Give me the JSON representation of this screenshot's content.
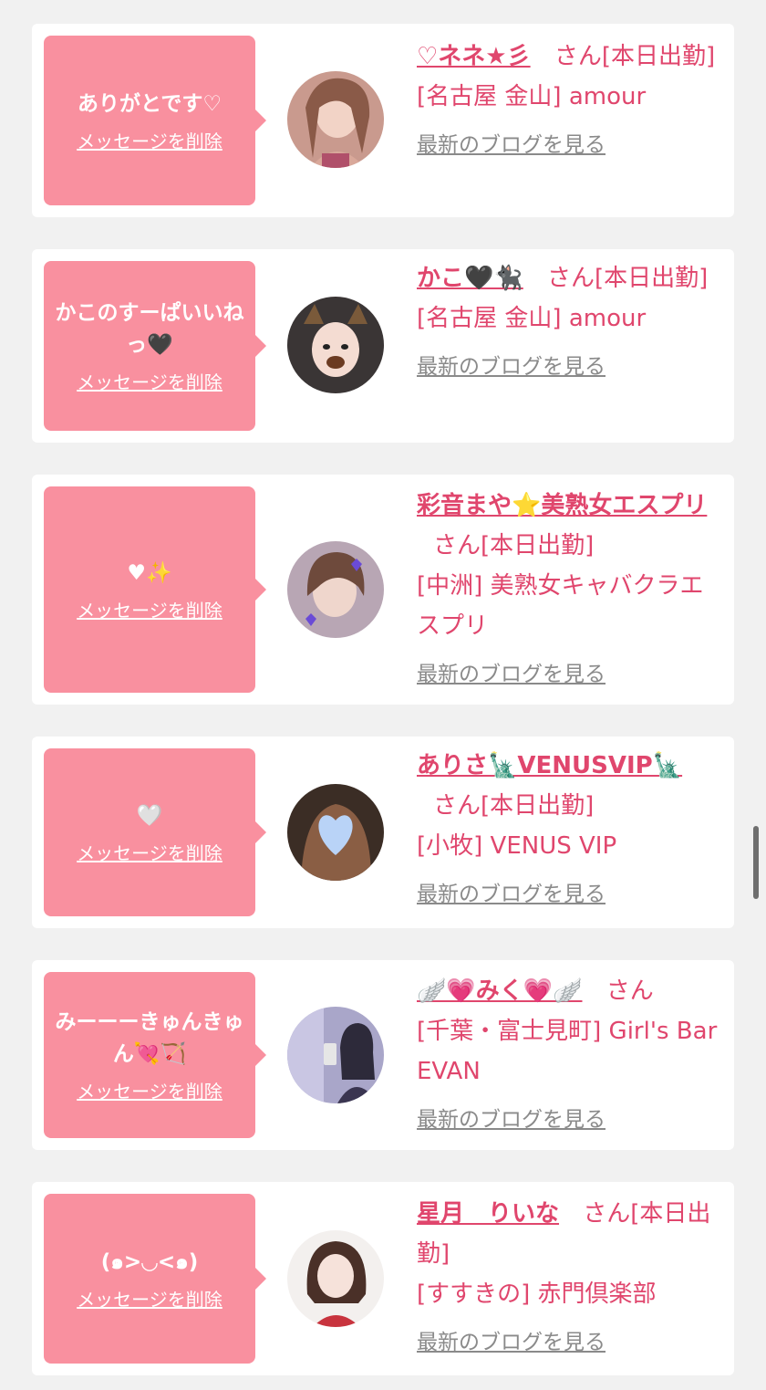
{
  "delete_label": "メッセージを削除",
  "blog_label": "最新のブログを見る",
  "messages": [
    {
      "text": "ありがとです♡",
      "name": "♡ネネ★彡",
      "san_suffix": "さん[本日出勤]",
      "shop": "[名古屋 金山] amour"
    },
    {
      "text": "かこのすーぱいいねっ🖤",
      "name": "かこ🖤🐈‍⬛",
      "san_suffix": "さん[本日出勤]",
      "shop": "[名古屋 金山] amour"
    },
    {
      "text": "♥✨",
      "name": "彩音まや⭐美熟女エスプリ",
      "san_suffix": "さん[本日出勤]",
      "shop": "[中洲] 美熟女キャバクラエスプリ"
    },
    {
      "text": "🤍",
      "name": "ありさ🗽VENUSVIP🗽",
      "san_suffix": "さん[本日出勤]",
      "shop": "[小牧] VENUS VIP"
    },
    {
      "text": "みーーーきゅんきゅん💘🏹",
      "name": "🪽💗みく💗🪽",
      "san_suffix": "さん",
      "shop": "[千葉・富士見町] Girl's Bar EVAN"
    },
    {
      "text": "(๑>◡<๑)",
      "name": "星月　りいな",
      "san_suffix": "さん[本日出勤]",
      "shop": "[すすきの] 赤門倶楽部"
    }
  ],
  "colors": {
    "bubble": "#f9909f",
    "accent": "#e0466d",
    "link_gray": "#8a8a8a",
    "background": "#f1f1f1"
  }
}
